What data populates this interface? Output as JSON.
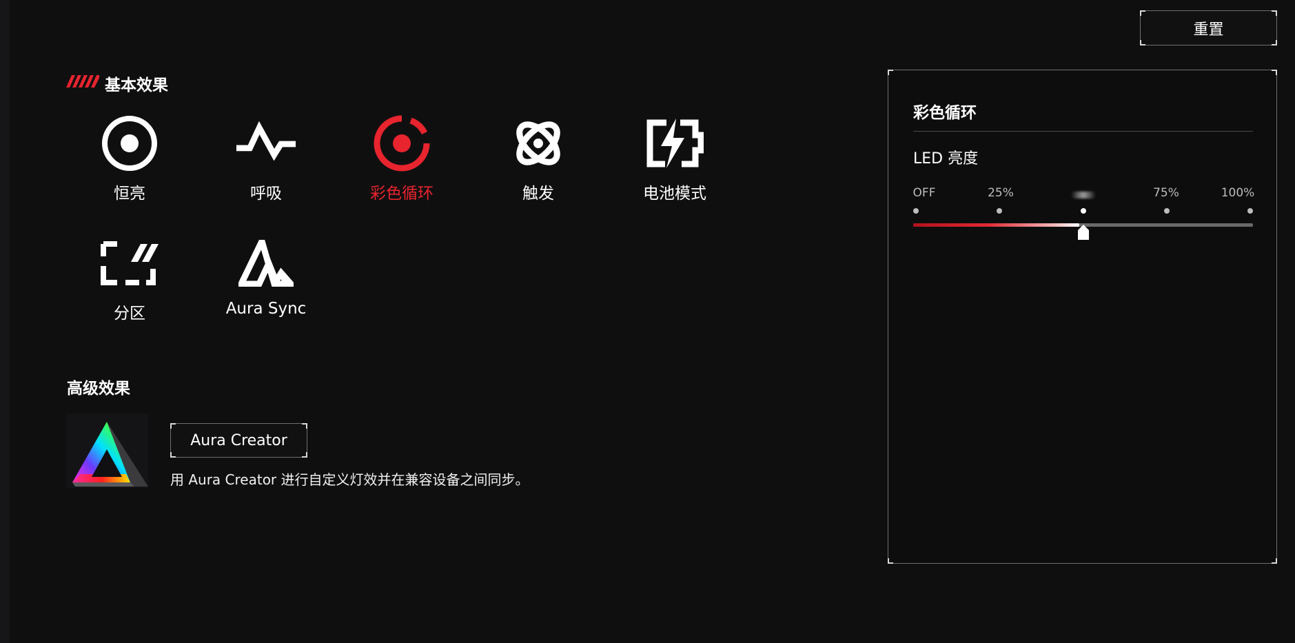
{
  "toolbar": {
    "reset_label": "重置"
  },
  "basic_effects": {
    "title": "基本效果",
    "items": [
      {
        "label": "恒亮",
        "icon": "static-icon"
      },
      {
        "label": "呼吸",
        "icon": "breathing-icon"
      },
      {
        "label": "彩色循环",
        "icon": "color-cycle-icon",
        "active": true
      },
      {
        "label": "触发",
        "icon": "trigger-icon"
      },
      {
        "label": "电池模式",
        "icon": "battery-mode-icon"
      },
      {
        "label": "分区",
        "icon": "zone-icon"
      },
      {
        "label": "Aura Sync",
        "icon": "aura-sync-icon"
      }
    ]
  },
  "advanced_effects": {
    "title": "高级效果",
    "creator_button_label": "Aura Creator",
    "description": "用 Aura Creator 进行自定义灯效并在兼容设备之间同步。"
  },
  "settings_panel": {
    "title": "彩色循环",
    "brightness_label": "LED 亮度",
    "ticks": [
      "OFF",
      "25%",
      "",
      "75%",
      "100%"
    ],
    "brightness_percent": 50
  },
  "colors": {
    "accent": "#e8242e",
    "background": "#0f0f10"
  }
}
